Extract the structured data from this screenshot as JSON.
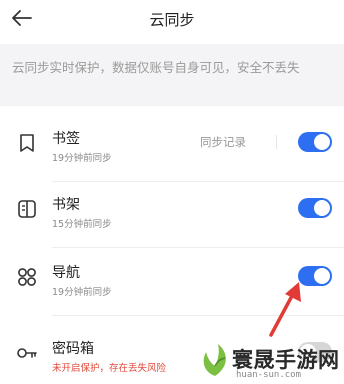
{
  "header": {
    "title": "云同步",
    "back_icon": "arrow-left-icon"
  },
  "notice": {
    "text": "云同步实时保护，数据仅账号自身可见，安全不丢失"
  },
  "rows": [
    {
      "icon": "bookmark-icon",
      "label": "书签",
      "sub": "19分钟前同步",
      "extra": "同步记录",
      "toggle_on": true
    },
    {
      "icon": "bookshelf-icon",
      "label": "书架",
      "sub": "15分钟前同步",
      "toggle_on": true
    },
    {
      "icon": "nav-grid-icon",
      "label": "导航",
      "sub": "19分钟前同步",
      "toggle_on": true
    },
    {
      "icon": "key-icon",
      "label": "密码箱",
      "sub": "未开启保护，存在丢失风险",
      "toggle_on": false
    }
  ],
  "colors": {
    "accent": "#2e6ef0",
    "warning": "#e04a3a",
    "arrow": "#e23a35"
  },
  "watermark": {
    "name": "寰晟手游网",
    "url": "huan-sun.com"
  }
}
